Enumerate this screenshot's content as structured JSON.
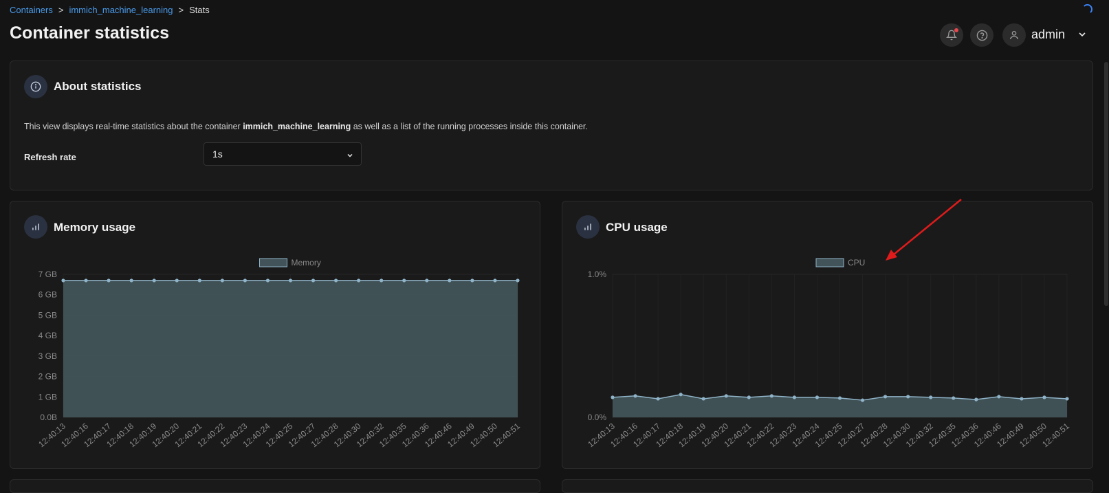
{
  "breadcrumb": {
    "root": "Containers",
    "container": "immich_machine_learning",
    "current": "Stats",
    "sep": ">"
  },
  "page_title": "Container statistics",
  "user": {
    "name": "admin"
  },
  "about": {
    "title": "About statistics",
    "desc_pre": "This view displays real-time statistics about the container ",
    "desc_container": "immich_machine_learning",
    "desc_post": " as well as a list of the running processes inside this container.",
    "refresh_label": "Refresh rate",
    "refresh_value": "1s"
  },
  "memory": {
    "title": "Memory usage"
  },
  "cpu": {
    "title": "CPU usage"
  },
  "colors": {
    "accent": "#4a9bea",
    "series_line": "#8fb3c8",
    "series_fill": "#425459",
    "annotation": "#e01b1b"
  },
  "chart_data": [
    {
      "type": "area",
      "legend": "Memory",
      "categories": [
        "12:40:13",
        "12:40:16",
        "12:40:17",
        "12:40:18",
        "12:40:19",
        "12:40:20",
        "12:40:21",
        "12:40:22",
        "12:40:23",
        "12:40:24",
        "12:40:25",
        "12:40:27",
        "12:40:28",
        "12:40:30",
        "12:40:32",
        "12:40:35",
        "12:40:36",
        "12:40:46",
        "12:40:49",
        "12:40:50",
        "12:40:51"
      ],
      "values": [
        6.7,
        6.7,
        6.7,
        6.7,
        6.7,
        6.7,
        6.7,
        6.7,
        6.7,
        6.7,
        6.7,
        6.7,
        6.7,
        6.7,
        6.7,
        6.7,
        6.7,
        6.7,
        6.7,
        6.7,
        6.7
      ],
      "ylim": [
        0,
        7
      ],
      "yticks": [
        "0.0B",
        "1 GB",
        "2 GB",
        "3 GB",
        "4 GB",
        "5 GB",
        "6 GB",
        "7 GB"
      ],
      "grid": true
    },
    {
      "type": "area",
      "legend": "CPU",
      "categories": [
        "12:40:13",
        "12:40:16",
        "12:40:17",
        "12:40:18",
        "12:40:19",
        "12:40:20",
        "12:40:21",
        "12:40:22",
        "12:40:23",
        "12:40:24",
        "12:40:25",
        "12:40:27",
        "12:40:28",
        "12:40:30",
        "12:40:32",
        "12:40:35",
        "12:40:36",
        "12:40:46",
        "12:40:49",
        "12:40:50",
        "12:40:51"
      ],
      "values": [
        0.14,
        0.15,
        0.13,
        0.16,
        0.13,
        0.15,
        0.14,
        0.15,
        0.14,
        0.14,
        0.135,
        0.12,
        0.145,
        0.145,
        0.14,
        0.135,
        0.125,
        0.145,
        0.13,
        0.14,
        0.13
      ],
      "ylim": [
        0,
        1.0
      ],
      "yticks": [
        "0.0%",
        "1.0%"
      ],
      "grid": true
    }
  ]
}
